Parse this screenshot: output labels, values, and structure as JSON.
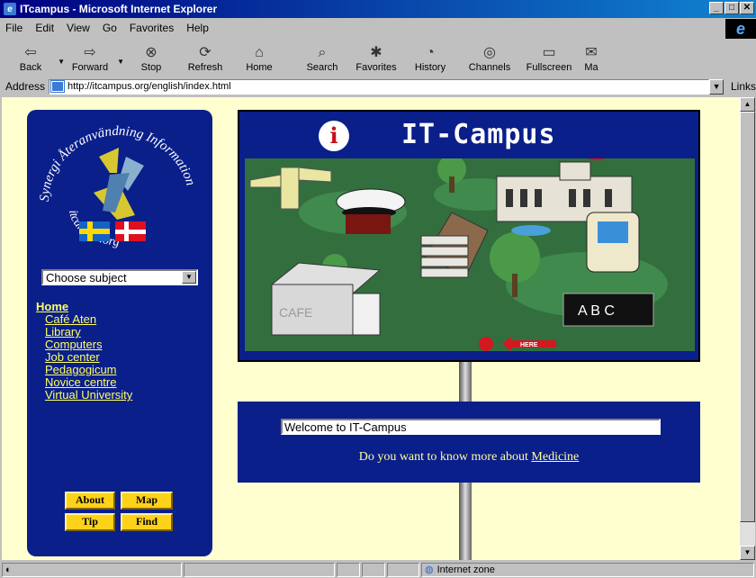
{
  "window": {
    "title": "ITcampus - Microsoft Internet Explorer"
  },
  "menu": [
    "File",
    "Edit",
    "View",
    "Go",
    "Favorites",
    "Help"
  ],
  "toolbar": [
    {
      "label": "Back",
      "icon": "back-arrow-icon",
      "dropdown": true
    },
    {
      "label": "Forward",
      "icon": "forward-arrow-icon",
      "dropdown": true
    },
    {
      "label": "Stop",
      "icon": "stop-icon",
      "dropdown": false
    },
    {
      "label": "Refresh",
      "icon": "refresh-icon",
      "dropdown": false
    },
    {
      "label": "Home",
      "icon": "home-icon",
      "dropdown": false
    },
    {
      "label": "Search",
      "icon": "search-icon",
      "dropdown": false
    },
    {
      "label": "Favorites",
      "icon": "favorites-icon",
      "dropdown": false
    },
    {
      "label": "History",
      "icon": "history-icon",
      "dropdown": false
    },
    {
      "label": "Channels",
      "icon": "channels-icon",
      "dropdown": false
    },
    {
      "label": "Fullscreen",
      "icon": "fullscreen-icon",
      "dropdown": false
    },
    {
      "label": "Ma",
      "icon": "mail-icon",
      "dropdown": false
    }
  ],
  "address": {
    "label": "Address",
    "url": "http://itcampus.org/english/index.html",
    "links_label": "Links"
  },
  "sidebar": {
    "logo_text_top": "Synergi Återanvändning Information",
    "logo_text_bottom": "itcampus.org",
    "subject_select": "Choose subject",
    "nav": [
      {
        "label": "Home",
        "active": true
      },
      {
        "label": "Café Aten"
      },
      {
        "label": "Library"
      },
      {
        "label": "Computers"
      },
      {
        "label": "Job center"
      },
      {
        "label": "Pedagogicum"
      },
      {
        "label": "Novice centre"
      },
      {
        "label": "Virtual University"
      }
    ],
    "buttons": {
      "about": "About",
      "map": "Map",
      "tip": "Tip",
      "find": "Find"
    }
  },
  "sign": {
    "info_letter": "i",
    "title": "IT-Campus",
    "scene_labels": {
      "cafe": "CAFE",
      "abc": "A B C",
      "here": "HERE"
    }
  },
  "welcome": {
    "marquee": "Welcome to IT-Campus",
    "question_prefix": "Do you want to know more about ",
    "question_link": "Medicine"
  },
  "status": {
    "zone": "Internet zone"
  },
  "colors": {
    "page_bg": "#ffffd0",
    "navy": "#0a1f8a",
    "link_yellow": "#ffff66",
    "button_yellow": "#ffd21a"
  }
}
